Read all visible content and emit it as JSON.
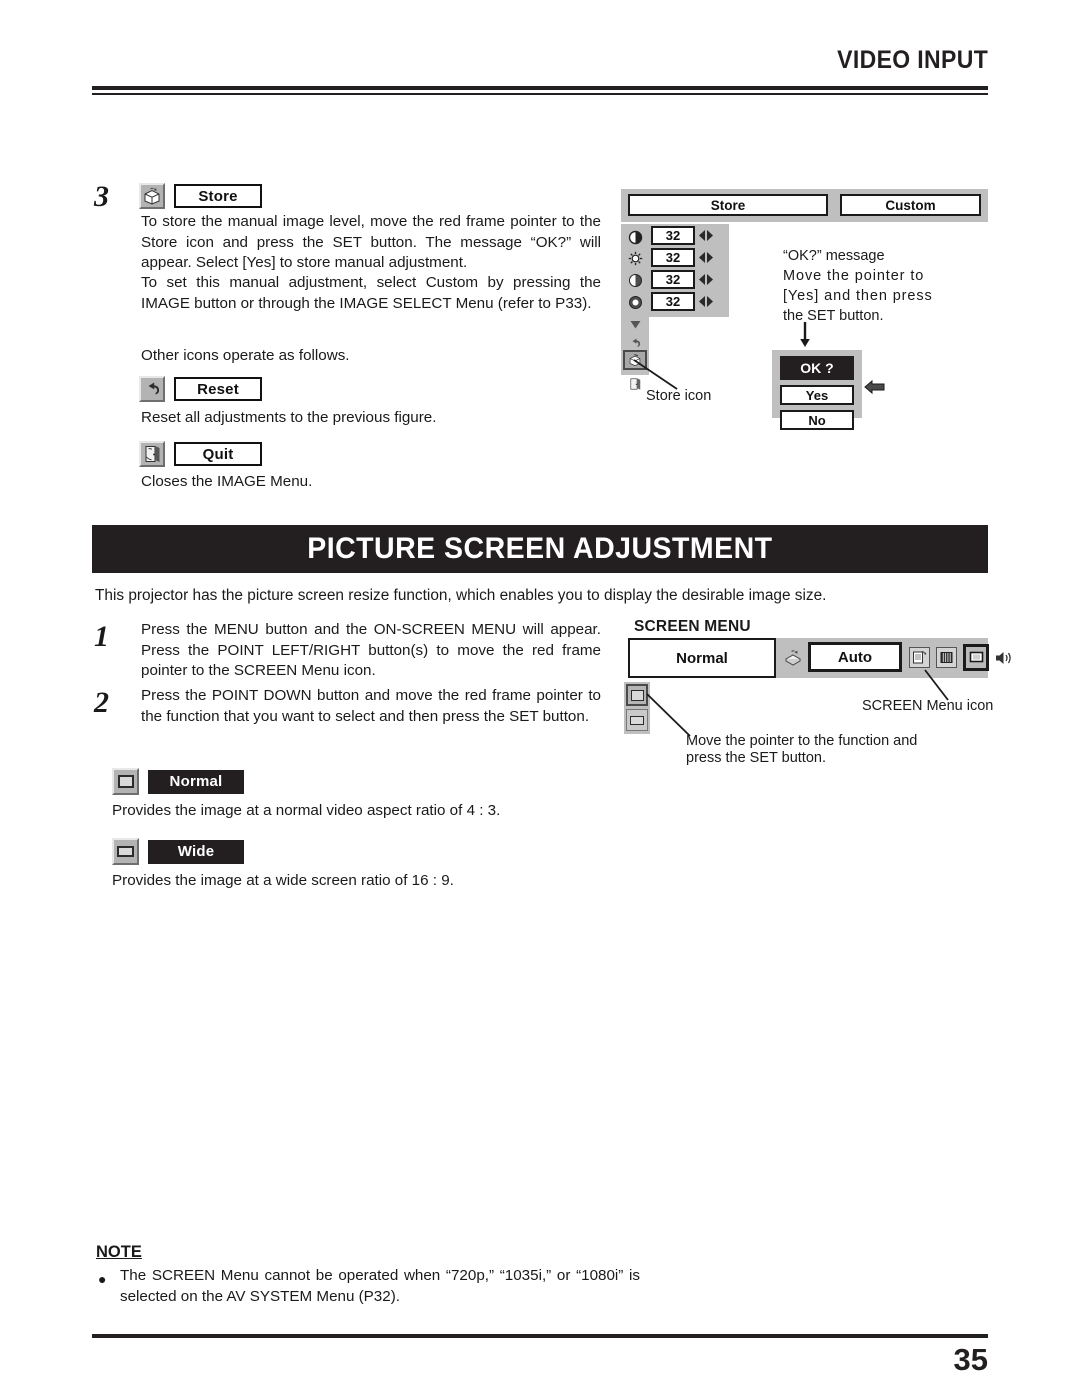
{
  "header": {
    "title": "VIDEO INPUT"
  },
  "step3": {
    "number": "3",
    "chip_label": "Store",
    "chip_icon": "store-box-icon",
    "paragraph1": "To store the manual image level, move the red frame pointer to the Store icon and press the SET button.  The message “OK?” will appear.  Select [Yes] to store manual adjustment.",
    "paragraph2": "To set this manual adjustment, select Custom by pressing the IMAGE button or through the IMAGE SELECT Menu (refer to P33).",
    "paragraph3": "Other icons operate as follows.",
    "reset": {
      "chip_label": "Reset",
      "chip_icon": "undo-arrow-icon",
      "description": "Reset all adjustments to the previous figure."
    },
    "quit": {
      "chip_label": "Quit",
      "chip_icon": "exit-door-icon",
      "description": "Closes the IMAGE Menu."
    }
  },
  "image_osd": {
    "tab_store": "Store",
    "tab_custom": "Custom",
    "rows": [
      {
        "icon": "contrast-icon",
        "value": "32"
      },
      {
        "icon": "brightness-icon",
        "value": "32"
      },
      {
        "icon": "color-icon",
        "value": "32"
      },
      {
        "icon": "tint-icon",
        "value": "32"
      }
    ],
    "extra_icons": [
      "sharpness-icon",
      "reset-icon",
      "store-icon",
      "quit-icon"
    ],
    "store_icon_caption": "Store icon",
    "ok_message_lines": [
      "“OK?” message",
      "Move the pointer to",
      "[Yes] and then press",
      "the SET button."
    ],
    "dialog": {
      "title": "OK ?",
      "options": [
        "Yes",
        "No"
      ],
      "pointer_on": "Yes"
    }
  },
  "picture_screen": {
    "banner": "PICTURE SCREEN ADJUSTMENT",
    "intro": "This projector has the picture screen resize function, which enables you to display the desirable image size.",
    "steps": [
      {
        "number": "1",
        "text": "Press the MENU button and the ON-SCREEN MENU will appear.  Press the POINT LEFT/RIGHT button(s) to move the red frame pointer to the SCREEN Menu icon."
      },
      {
        "number": "2",
        "text": "Press the POINT DOWN button and move the red frame pointer to the function that you want to select and then press the SET button."
      }
    ],
    "options": [
      {
        "chip_label": "Normal",
        "chip_icon": "normal-screen-icon",
        "description": "Provides the image at a normal video aspect ratio of 4 : 3."
      },
      {
        "chip_label": "Wide",
        "chip_icon": "wide-screen-icon",
        "description": "Provides the image at a wide screen ratio of 16 : 9."
      }
    ]
  },
  "screen_menu": {
    "title": "SCREEN MENU",
    "selected_label": "Normal",
    "auto_label": "Auto",
    "toolbar_icons": [
      "pc-adjust-icon",
      "image-select-icon",
      "image-adjust-icon",
      "screen-menu-icon",
      "sound-icon"
    ],
    "menu_icon_caption": "SCREEN Menu icon",
    "pointer_caption_lines": [
      "Move the pointer to the function and",
      "press the SET button."
    ],
    "side_icons": [
      "normal-screen-icon",
      "wide-screen-icon"
    ]
  },
  "note": {
    "title": "NOTE",
    "bullet": "●",
    "text": "The SCREEN Menu cannot be operated when “720p,” “1035i,” or “1080i” is selected on the AV SYSTEM Menu (P32)."
  },
  "footer": {
    "page_number": "35"
  }
}
